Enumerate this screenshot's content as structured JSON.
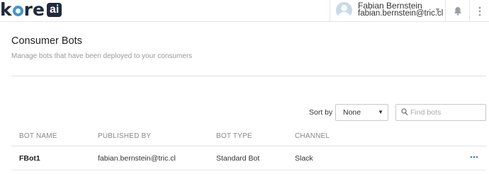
{
  "header": {
    "logo_text": "kore",
    "logo_badge": "ai",
    "user": {
      "name": "Fabian Bernstein",
      "email": "fabian.bernstein@tric.cl"
    },
    "icons": [
      "avatar",
      "chevron-down-icon",
      "bell-icon",
      "more-vertical-icon"
    ]
  },
  "page": {
    "title": "Consumer Bots",
    "subtitle": "Manage bots that have been deployed to your consumers"
  },
  "controls": {
    "sort_label": "Sort by",
    "sort_value": "None",
    "search_placeholder": "Find bots"
  },
  "table": {
    "columns": [
      "BOT NAME",
      "PUBLISHED BY",
      "BOT TYPE",
      "CHANNEL"
    ],
    "rows": [
      {
        "bot_name": "FBot1",
        "published_by": "fabian.bernstein@tric.cl",
        "bot_type": "Standard Bot",
        "channel": "Slack"
      }
    ]
  },
  "colors": {
    "accent": "#3a7fc4",
    "logo_dark": "#1f2a3c",
    "logo_ring": "#3f97c9"
  }
}
